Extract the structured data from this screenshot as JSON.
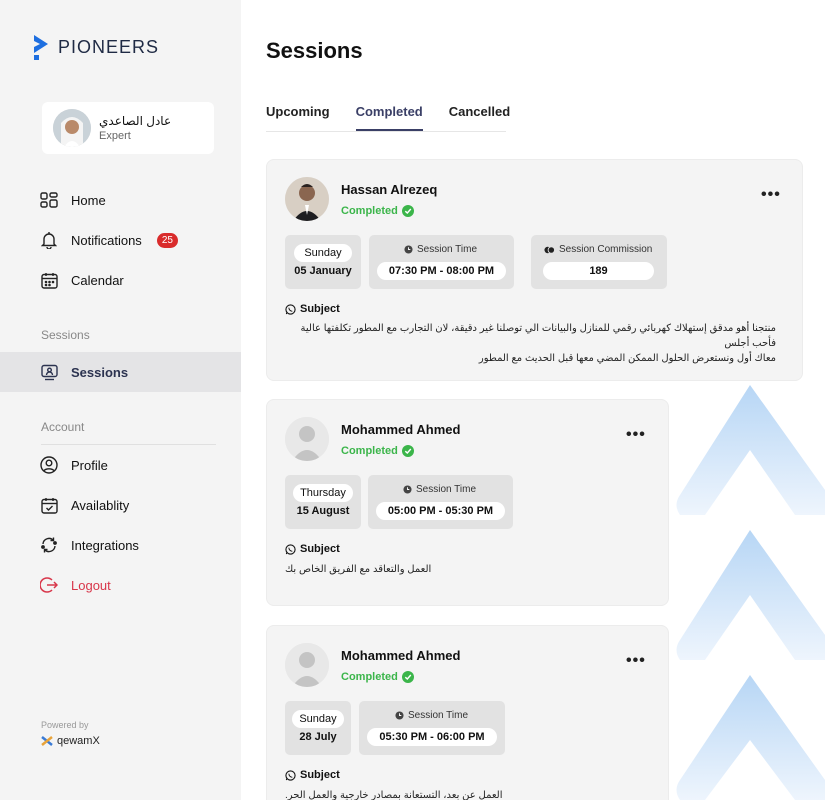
{
  "brand": {
    "name": "PIONEERS",
    "accent": "#1e6fe0"
  },
  "user": {
    "name": "عادل الصاعدي",
    "role": "Expert"
  },
  "nav": {
    "home": "Home",
    "notifications": "Notifications",
    "notifications_count": "25",
    "calendar": "Calendar",
    "sessions_section": "Sessions",
    "sessions": "Sessions",
    "account_section": "Account",
    "profile": "Profile",
    "availability": "Availablity",
    "integrations": "Integrations",
    "logout": "Logout"
  },
  "footer": {
    "powered_by": "Powered by",
    "vendor": "qewamX"
  },
  "page": {
    "title": "Sessions"
  },
  "tabs": [
    {
      "label": "Upcoming"
    },
    {
      "label": "Completed"
    },
    {
      "label": "Cancelled"
    }
  ],
  "status_color": "#3bb54a",
  "sessions": [
    {
      "name": "Hassan Alrezeq",
      "status": "Completed",
      "day": "Sunday",
      "date": "05 January",
      "time_label": "Session Time",
      "time": "07:30 PM - 08:00 PM",
      "commission_label": "Session Commission",
      "commission": "189",
      "subject_label": "Subject",
      "subject_line1": "منتجنا أهو مدقق إستهلاك كهربائي رقمي للمنازل والبيانات الي توصلنا غير دقيقة، لان التجارب مع المطور تكلفتها عالية فأحب أجلس",
      "subject_line2": "معاك أول ونستعرض الحلول الممكن المضي معها قبل الحديث مع المطور"
    },
    {
      "name": "Mohammed Ahmed",
      "status": "Completed",
      "day": "Thursday",
      "date": "15 August",
      "time_label": "Session Time",
      "time": "05:00 PM - 05:30 PM",
      "subject_label": "Subject",
      "subject_line1": "العمل والتعاقد مع الفريق الخاص بك"
    },
    {
      "name": "Mohammed Ahmed",
      "status": "Completed",
      "day": "Sunday",
      "date": "28 July",
      "time_label": "Session Time",
      "time": "05:30 PM - 06:00 PM",
      "subject_label": "Subject",
      "subject_line1": "العمل عن بعد، التستعانة بمصادر خارجية والعمل الحر."
    }
  ]
}
